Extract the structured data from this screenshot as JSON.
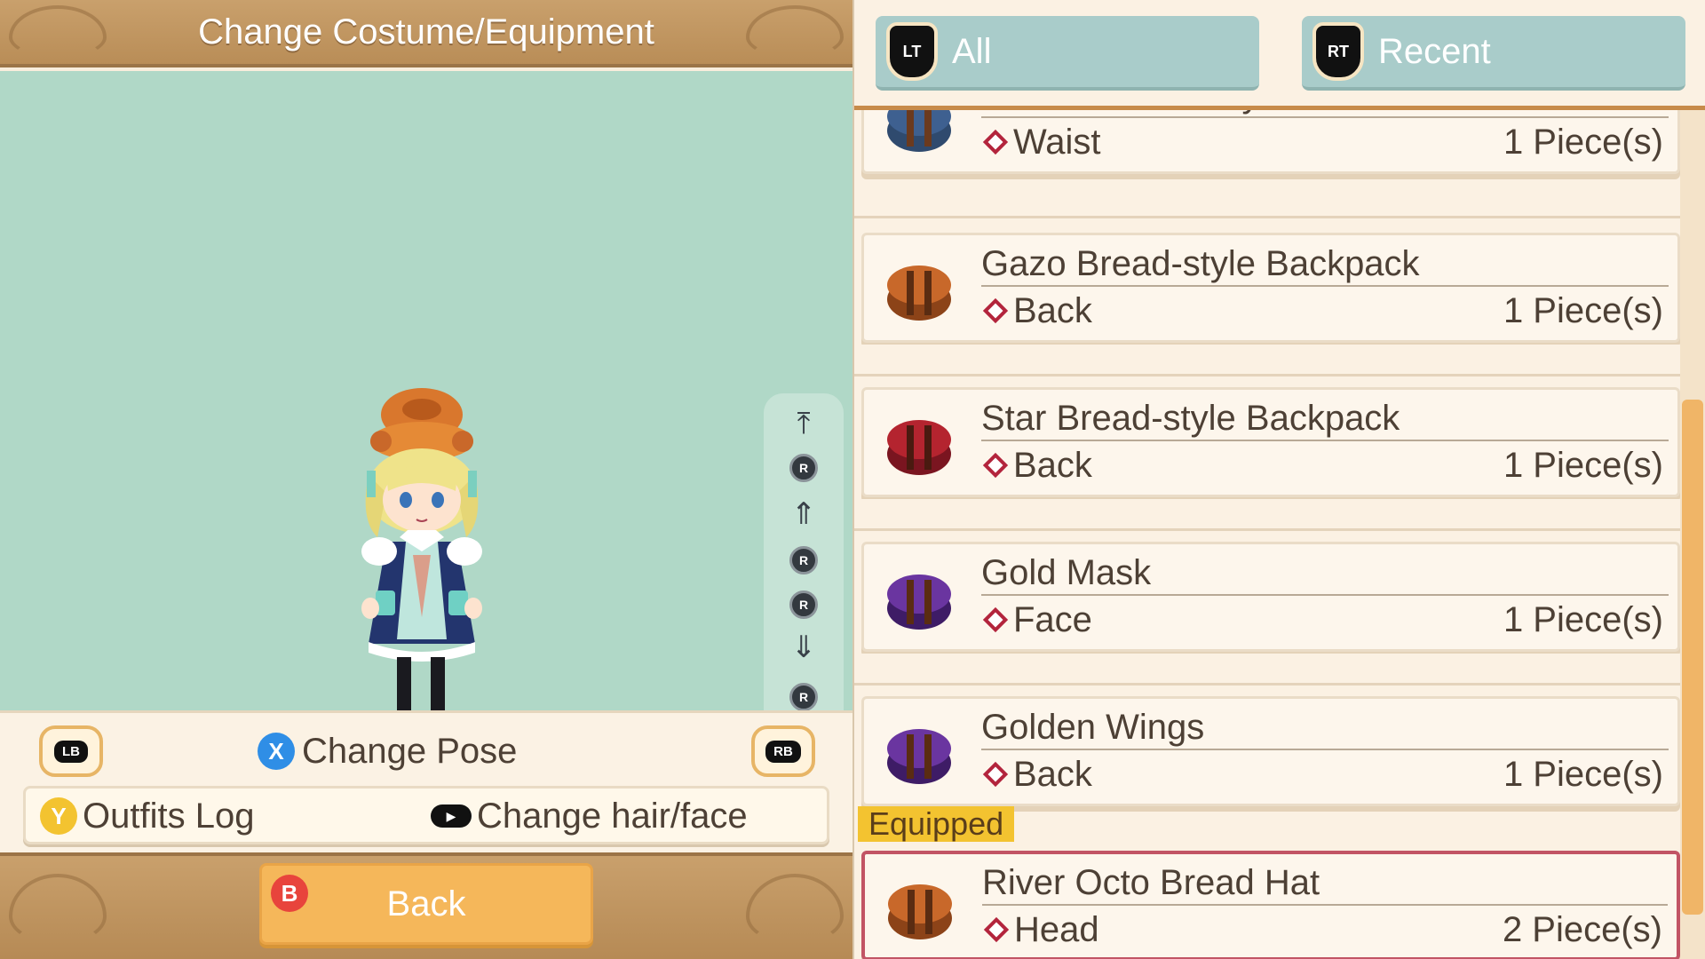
{
  "header": {
    "title": "Change Costume/Equipment"
  },
  "preview": {
    "camera_controls": [
      "scroll-to-top",
      "rotate-up",
      "zoom-in",
      "rotate-left",
      "rotate-right",
      "zoom-out",
      "rotate-down",
      "scroll-to-bottom"
    ],
    "rstick_label": "R"
  },
  "controls": {
    "lb_label": "LB",
    "rb_label": "RB",
    "x_label": "X",
    "change_pose": "Change Pose",
    "y_label": "Y",
    "outfits_log": "Outfits Log",
    "change_hair_face": "Change hair/face",
    "b_label": "B",
    "back": "Back"
  },
  "tabs": [
    {
      "badge": "LT",
      "label": "All"
    },
    {
      "badge": "RT",
      "label": "Recent"
    }
  ],
  "items": [
    {
      "name": "Shishin Bread-style Canteen",
      "slot": "Waist",
      "qty": "1 Piece(s)",
      "icon_color": "#2f4a6e"
    },
    {
      "name": "Gazo Bread-style Backpack",
      "slot": "Back",
      "qty": "1 Piece(s)",
      "icon_color": "#b55a22"
    },
    {
      "name": "Star Bread-style Backpack",
      "slot": "Back",
      "qty": "1 Piece(s)",
      "icon_color": "#a51f2a"
    },
    {
      "name": "Gold Mask",
      "slot": "Face",
      "qty": "1 Piece(s)",
      "icon_color": "#5a2c8c"
    },
    {
      "name": "Golden Wings",
      "slot": "Back",
      "qty": "1 Piece(s)",
      "icon_color": "#5a2c8c"
    }
  ],
  "equipped": {
    "label": "Equipped",
    "item": {
      "name": "River Octo Bread Hat",
      "slot": "Head",
      "qty": "2 Piece(s)",
      "icon_color": "#b55a22"
    }
  },
  "colors": {
    "preview_bg": "#b0d8c7",
    "accent": "#f5b75a",
    "equipped_border": "#c25464",
    "tab_bg": "#a9ccca"
  }
}
